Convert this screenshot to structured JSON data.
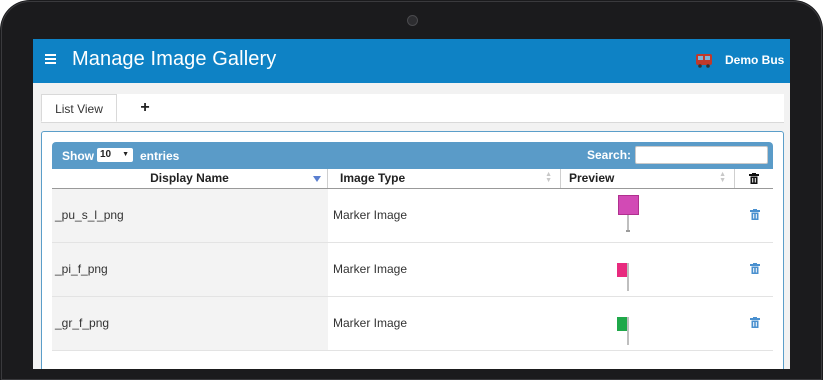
{
  "header": {
    "title": "Manage Image Gallery",
    "user": "Demo Bus"
  },
  "tabs": [
    {
      "label": "List View"
    },
    {
      "label": "+"
    }
  ],
  "table": {
    "show_label": "Show",
    "entries_value": "10",
    "entries_label": "entries",
    "search_label": "Search:",
    "search_value": "",
    "columns": [
      "Display Name",
      "Image Type",
      "Preview"
    ],
    "rows": [
      {
        "name": "_pu_s_l_png",
        "type": "Marker Image",
        "flag_color": "#d24ab5"
      },
      {
        "name": "_pi_f_png",
        "type": "Marker Image",
        "flag_color": "#e82a7e"
      },
      {
        "name": "_gr_f_png",
        "type": "Marker Image",
        "flag_color": "#1fa84a"
      }
    ]
  },
  "colors": {
    "topbar": "#0e82c5",
    "table_bar": "#5a9bc8",
    "delete_icon": "#4a90cf"
  }
}
